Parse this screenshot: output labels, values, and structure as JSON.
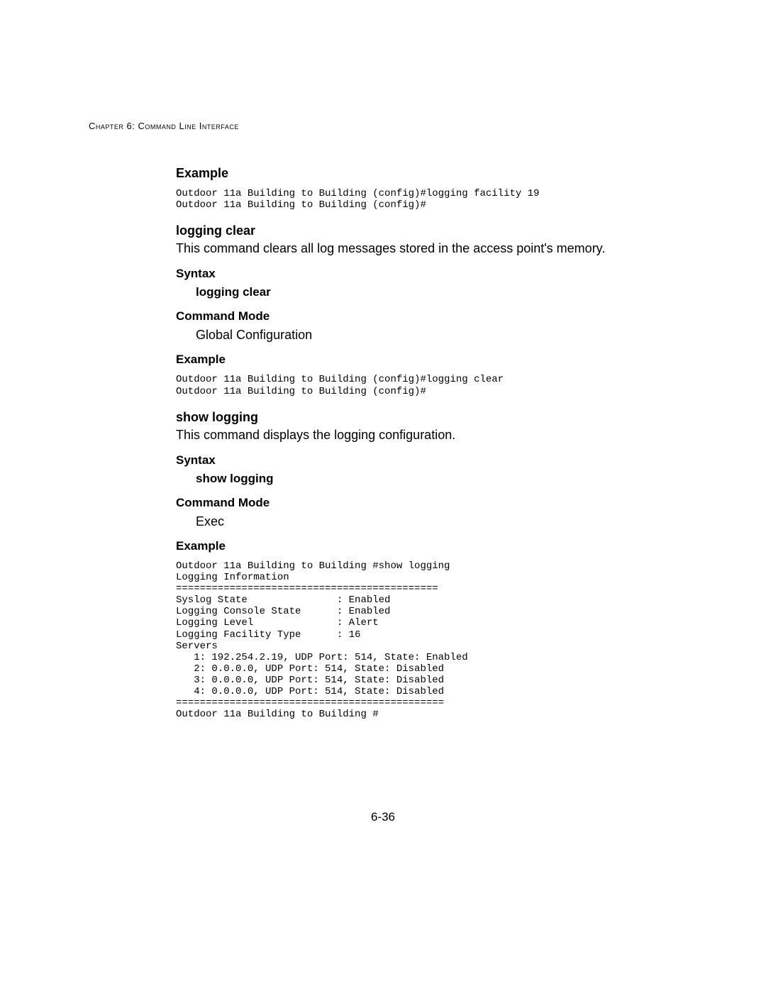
{
  "header": {
    "chapter_label": "Chapter 6: Command Line Interface"
  },
  "sections": {
    "example1": {
      "heading": "Example",
      "code": "Outdoor 11a Building to Building (config)#logging facility 19\nOutdoor 11a Building to Building (config)#"
    },
    "logging_clear": {
      "title": "logging clear",
      "description": "This command clears all log messages stored in the access point's memory.",
      "syntax_heading": "Syntax",
      "syntax_value": "logging clear",
      "mode_heading": "Command Mode",
      "mode_value": "Global Configuration",
      "example_heading": "Example",
      "example_code": "Outdoor 11a Building to Building (config)#logging clear\nOutdoor 11a Building to Building (config)#"
    },
    "show_logging": {
      "title": "show logging",
      "description": "This command displays the logging configuration.",
      "syntax_heading": "Syntax",
      "syntax_value": "show logging",
      "mode_heading": "Command Mode",
      "mode_value": "Exec",
      "example_heading": "Example",
      "example_code": "Outdoor 11a Building to Building #show logging\nLogging Information\n============================================\nSyslog State               : Enabled\nLogging Console State      : Enabled\nLogging Level              : Alert\nLogging Facility Type      : 16\nServers\n   1: 192.254.2.19, UDP Port: 514, State: Enabled\n   2: 0.0.0.0, UDP Port: 514, State: Disabled\n   3: 0.0.0.0, UDP Port: 514, State: Disabled\n   4: 0.0.0.0, UDP Port: 514, State: Disabled\n=============================================\nOutdoor 11a Building to Building #"
    }
  },
  "footer": {
    "page_number": "6-36"
  }
}
